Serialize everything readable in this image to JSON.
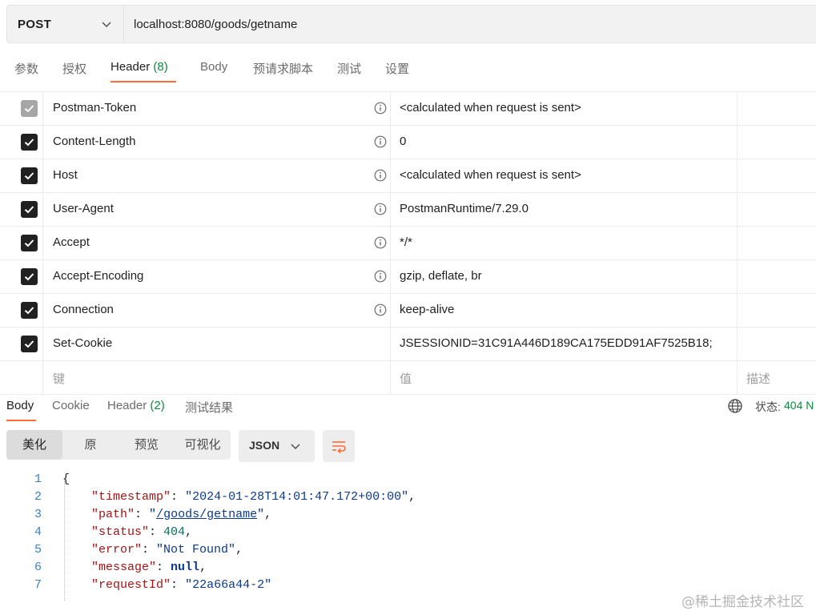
{
  "request": {
    "method": "POST",
    "url": "localhost:8080/goods/getname"
  },
  "request_tabs": [
    {
      "label": "参数"
    },
    {
      "label": "授权"
    },
    {
      "label": "Header",
      "count": "(8)"
    },
    {
      "label": "Body"
    },
    {
      "label": "预请求脚本"
    },
    {
      "label": "测试"
    },
    {
      "label": "设置"
    }
  ],
  "headers": [
    {
      "key": "Postman-Token",
      "value": "<calculated when request is sent>",
      "checked": true,
      "disabled": true,
      "info": true
    },
    {
      "key": "Content-Length",
      "value": "0",
      "checked": true,
      "disabled": false,
      "info": true
    },
    {
      "key": "Host",
      "value": "<calculated when request is sent>",
      "checked": true,
      "disabled": false,
      "info": true
    },
    {
      "key": "User-Agent",
      "value": "PostmanRuntime/7.29.0",
      "checked": true,
      "disabled": false,
      "info": true
    },
    {
      "key": "Accept",
      "value": "*/*",
      "checked": true,
      "disabled": false,
      "info": true
    },
    {
      "key": "Accept-Encoding",
      "value": "gzip, deflate, br",
      "checked": true,
      "disabled": false,
      "info": true
    },
    {
      "key": "Connection",
      "value": "keep-alive",
      "checked": true,
      "disabled": false,
      "info": true
    },
    {
      "key": "Set-Cookie",
      "value": "JSESSIONID=31C91A446D189CA175EDD91AF7525B18;",
      "checked": true,
      "disabled": false,
      "info": false
    }
  ],
  "new_row": {
    "key_placeholder": "键",
    "value_placeholder": "值",
    "desc_placeholder": "描述"
  },
  "response_tabs": [
    {
      "label": "Body"
    },
    {
      "label": "Cookie"
    },
    {
      "label": "Header",
      "count": "(2)"
    },
    {
      "label": "测试结果"
    }
  ],
  "status": {
    "label": "状态:",
    "value": "404 N"
  },
  "view_modes": [
    "美化",
    "原",
    "预览",
    "可视化"
  ],
  "active_view_mode": "美化",
  "format": "JSON",
  "code_lines": [
    {
      "n": "1",
      "text": "{"
    },
    {
      "n": "2",
      "text": "    \"timestamp\": \"2024-01-28T14:01:47.172+00:00\","
    },
    {
      "n": "3",
      "text": "    \"path\": \"/goods/getname\","
    },
    {
      "n": "4",
      "text": "    \"status\": 404,"
    },
    {
      "n": "5",
      "text": "    \"error\": \"Not Found\","
    },
    {
      "n": "6",
      "text": "    \"message\": null,"
    },
    {
      "n": "7",
      "text": "    \"requestId\": \"22a66a44-2\""
    }
  ],
  "code": {
    "timestamp_key": "\"timestamp\"",
    "timestamp_val": "\"2024-01-28T14:01:47.172+00:00\"",
    "path_key": "\"path\"",
    "path_val": "/goods/getname",
    "status_key": "\"status\"",
    "status_val": "404",
    "error_key": "\"error\"",
    "error_val": "\"Not Found\"",
    "message_key": "\"message\"",
    "message_val": "null",
    "requestId_key": "\"requestId\"",
    "requestId_val": "\"22a66a44-2\""
  },
  "watermark": "@稀土掘金技术社区",
  "colors": {
    "accent": "#ff6c37",
    "success": "#0a8a3e"
  }
}
